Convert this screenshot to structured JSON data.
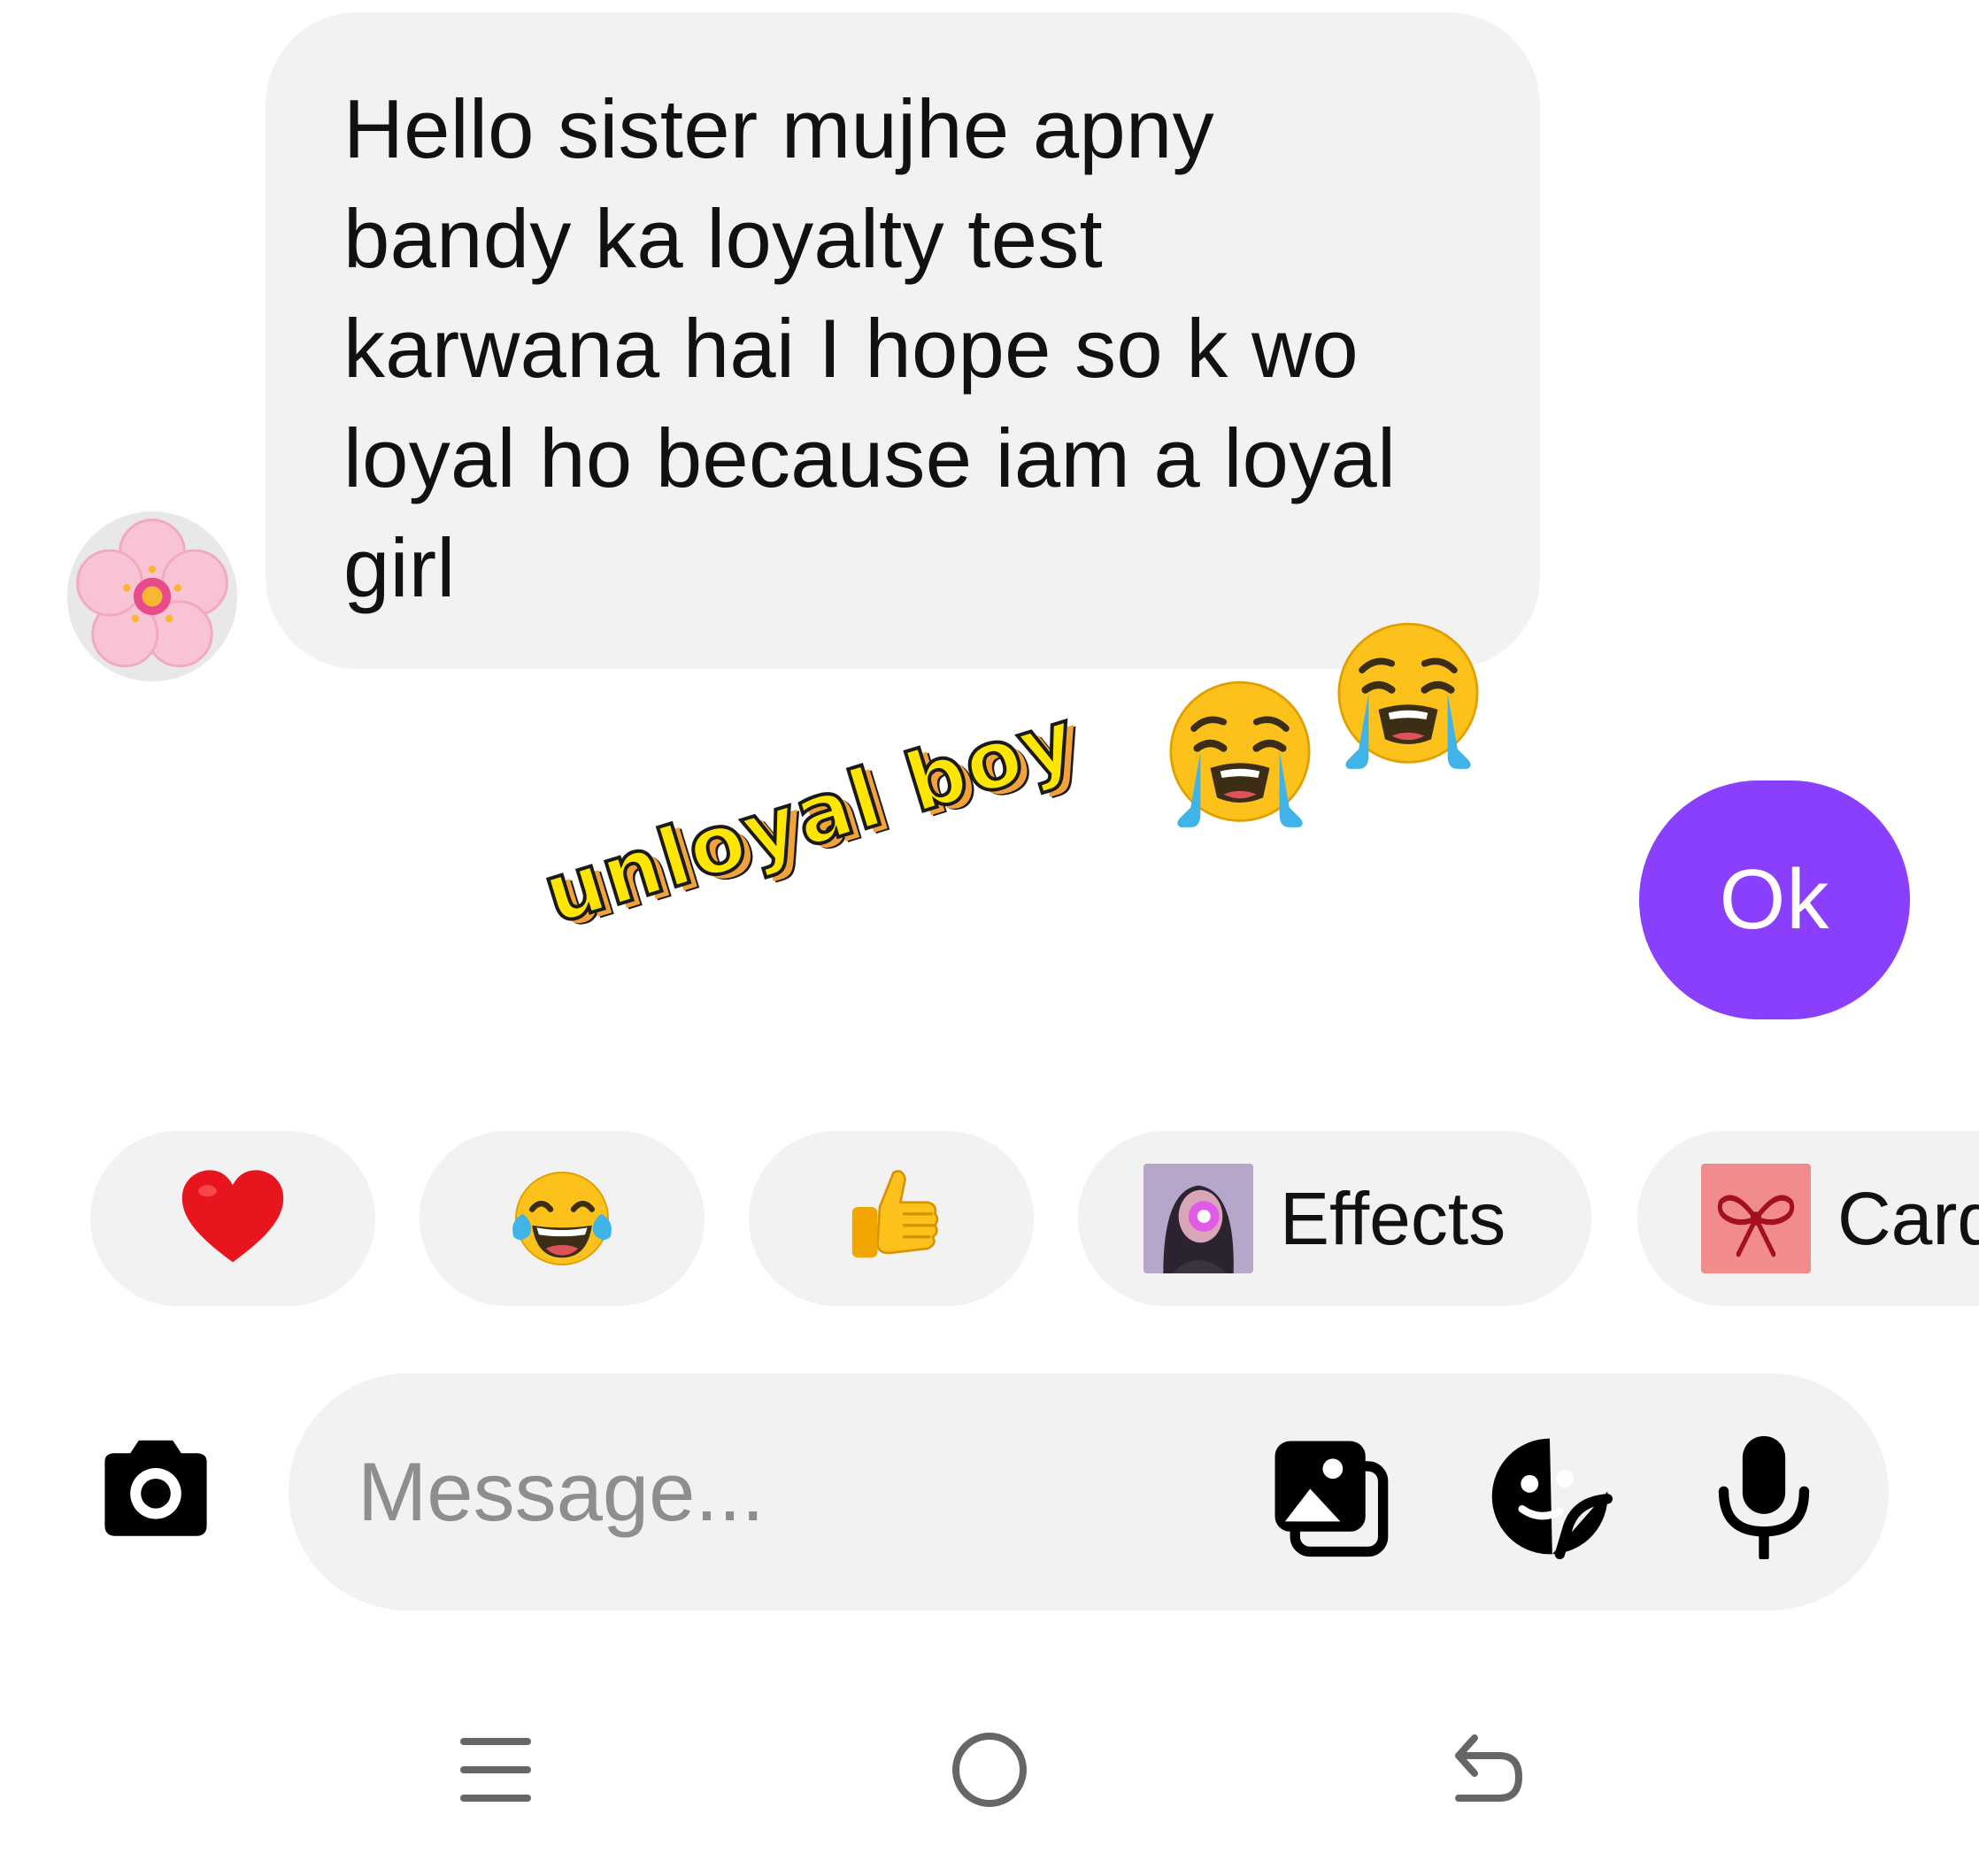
{
  "conversation": {
    "incoming_message": "Hello sister mujhe apny\nbandy ka loyalty test\nkarwana hai I hope so k wo\nloyal ho because iam a loyal\ngirl",
    "avatar_icon": "cherry-blossom",
    "outgoing_message": "Ok"
  },
  "overlay": {
    "caption": "unloyal boy",
    "emojis": [
      "loudly-crying-face",
      "loudly-crying-face"
    ]
  },
  "quick_replies": {
    "chips": [
      {
        "icon": "red-heart"
      },
      {
        "icon": "face-with-tears-of-joy"
      },
      {
        "icon": "thumbs-up"
      },
      {
        "icon": "effects-thumbnail",
        "label": "Effects"
      },
      {
        "icon": "gift-bow",
        "label": "Card"
      }
    ]
  },
  "composer": {
    "placeholder": "Message...",
    "value": "",
    "icons": [
      "camera-icon",
      "gallery-icon",
      "sticker-icon",
      "mic-icon"
    ]
  },
  "navigation": {
    "icons": [
      "recents-icon",
      "home-icon",
      "back-icon"
    ]
  },
  "colors": {
    "outgoing_bubble": "#8a3ffc",
    "incoming_bubble": "#f2f2f2",
    "chip_background": "#f2f2f2",
    "placeholder": "#8e8e8e",
    "overlay_text": "#ffe600"
  }
}
